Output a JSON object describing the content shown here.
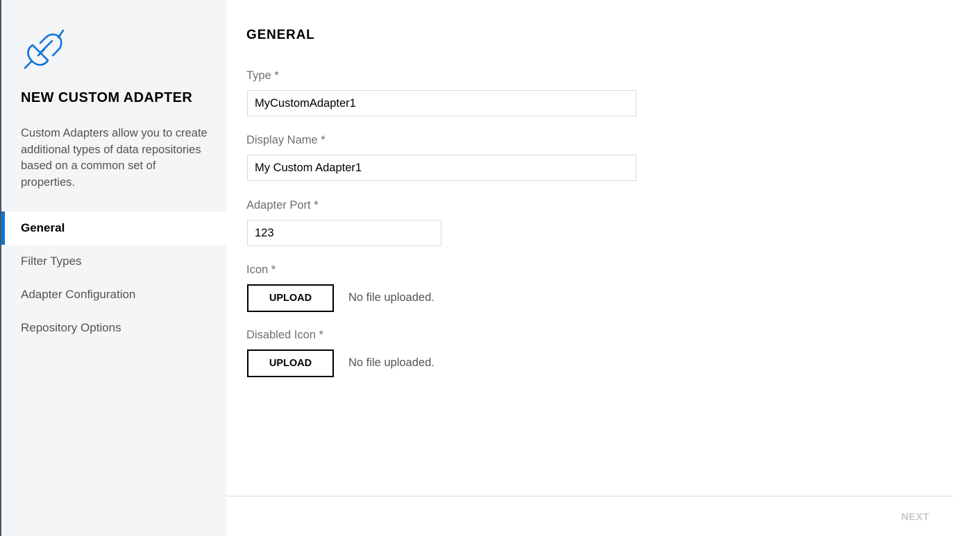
{
  "sidebar": {
    "icon": "plug-icon",
    "title": "NEW CUSTOM ADAPTER",
    "description": "Custom Adapters allow you to create additional types of data repositories based on a common set of properties.",
    "nav": [
      {
        "label": "General",
        "active": true
      },
      {
        "label": "Filter Types",
        "active": false
      },
      {
        "label": "Adapter Configuration",
        "active": false
      },
      {
        "label": "Repository Options",
        "active": false
      }
    ]
  },
  "main": {
    "section_title": "GENERAL",
    "fields": {
      "type": {
        "label": "Type *",
        "value": "MyCustomAdapter1"
      },
      "display_name": {
        "label": "Display Name *",
        "value": "My Custom Adapter1"
      },
      "adapter_port": {
        "label": "Adapter Port *",
        "value": "123"
      },
      "icon": {
        "label": "Icon *",
        "button_label": "UPLOAD",
        "status": "No file uploaded."
      },
      "disabled_icon": {
        "label": "Disabled Icon *",
        "button_label": "UPLOAD",
        "status": "No file uploaded."
      }
    }
  },
  "footer": {
    "next_label": "NEXT"
  },
  "colors": {
    "accent": "#0b73da",
    "sidebar_bg": "#f4f5f7",
    "next_disabled": "#c8c8c8"
  }
}
